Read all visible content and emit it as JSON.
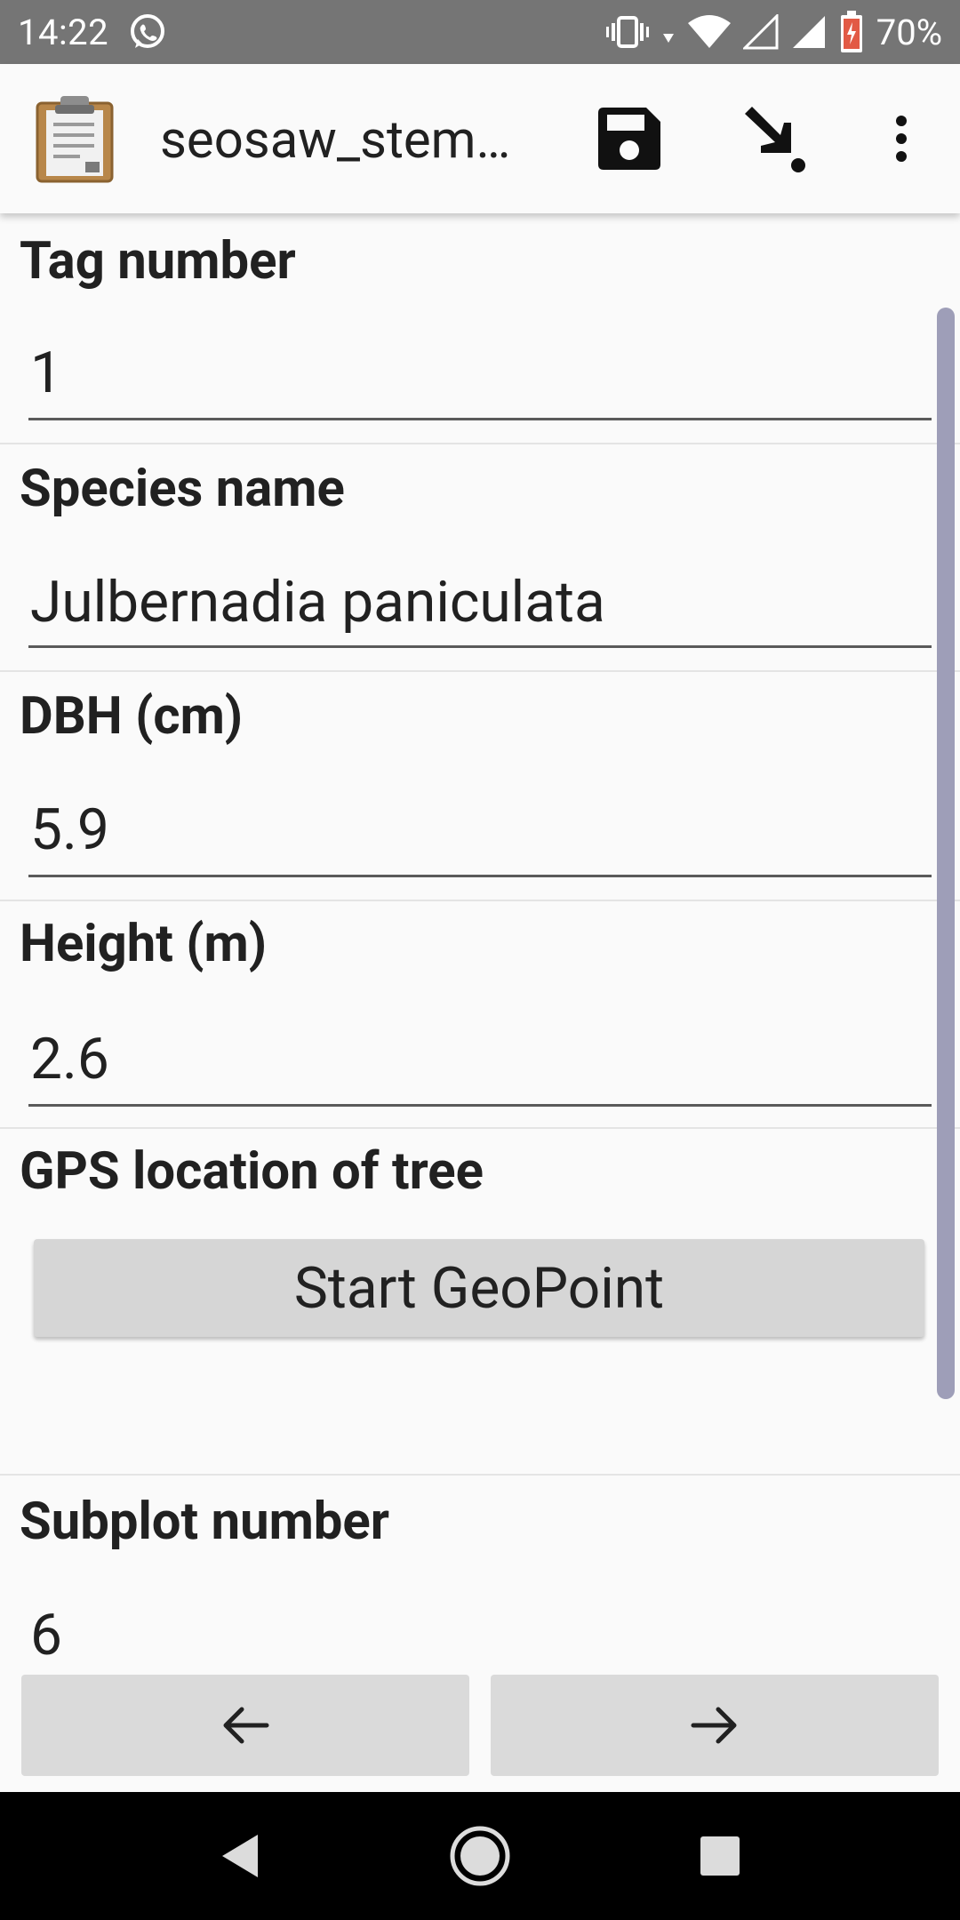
{
  "status_bar": {
    "time": "14:22",
    "battery_percent": "70%",
    "icons": [
      "whatsapp-icon",
      "vibrate-icon",
      "data-arrows-icon",
      "wifi-icon",
      "signal-empty-icon",
      "signal-full-icon",
      "battery-charging-icon"
    ]
  },
  "app_bar": {
    "title": "seosaw_stem…",
    "icons": [
      "clipboard-icon",
      "save-icon",
      "jump-icon",
      "more-vert-icon"
    ]
  },
  "form": {
    "questions": [
      {
        "label": "Tag number",
        "value": "1"
      },
      {
        "label": "Species name",
        "value": "Julbernadia paniculata"
      },
      {
        "label": "DBH (cm)",
        "value": "5.9"
      },
      {
        "label": "Height (m)",
        "value": "2.6"
      },
      {
        "label": "GPS location of tree",
        "button": "Start GeoPoint"
      },
      {
        "label": "Subplot number",
        "value": "6"
      }
    ]
  },
  "nav": {
    "back_icon": "arrow-left-icon",
    "next_icon": "arrow-right-icon"
  },
  "system_nav": {
    "icons": [
      "back-triangle-icon",
      "home-circle-icon",
      "recents-square-icon"
    ]
  },
  "colors": {
    "status_bar": "#757575",
    "app_bar": "#fafafa",
    "button": "#d6d6d6",
    "scrollbar": "#9e9eb8",
    "system_nav": "#000000"
  }
}
